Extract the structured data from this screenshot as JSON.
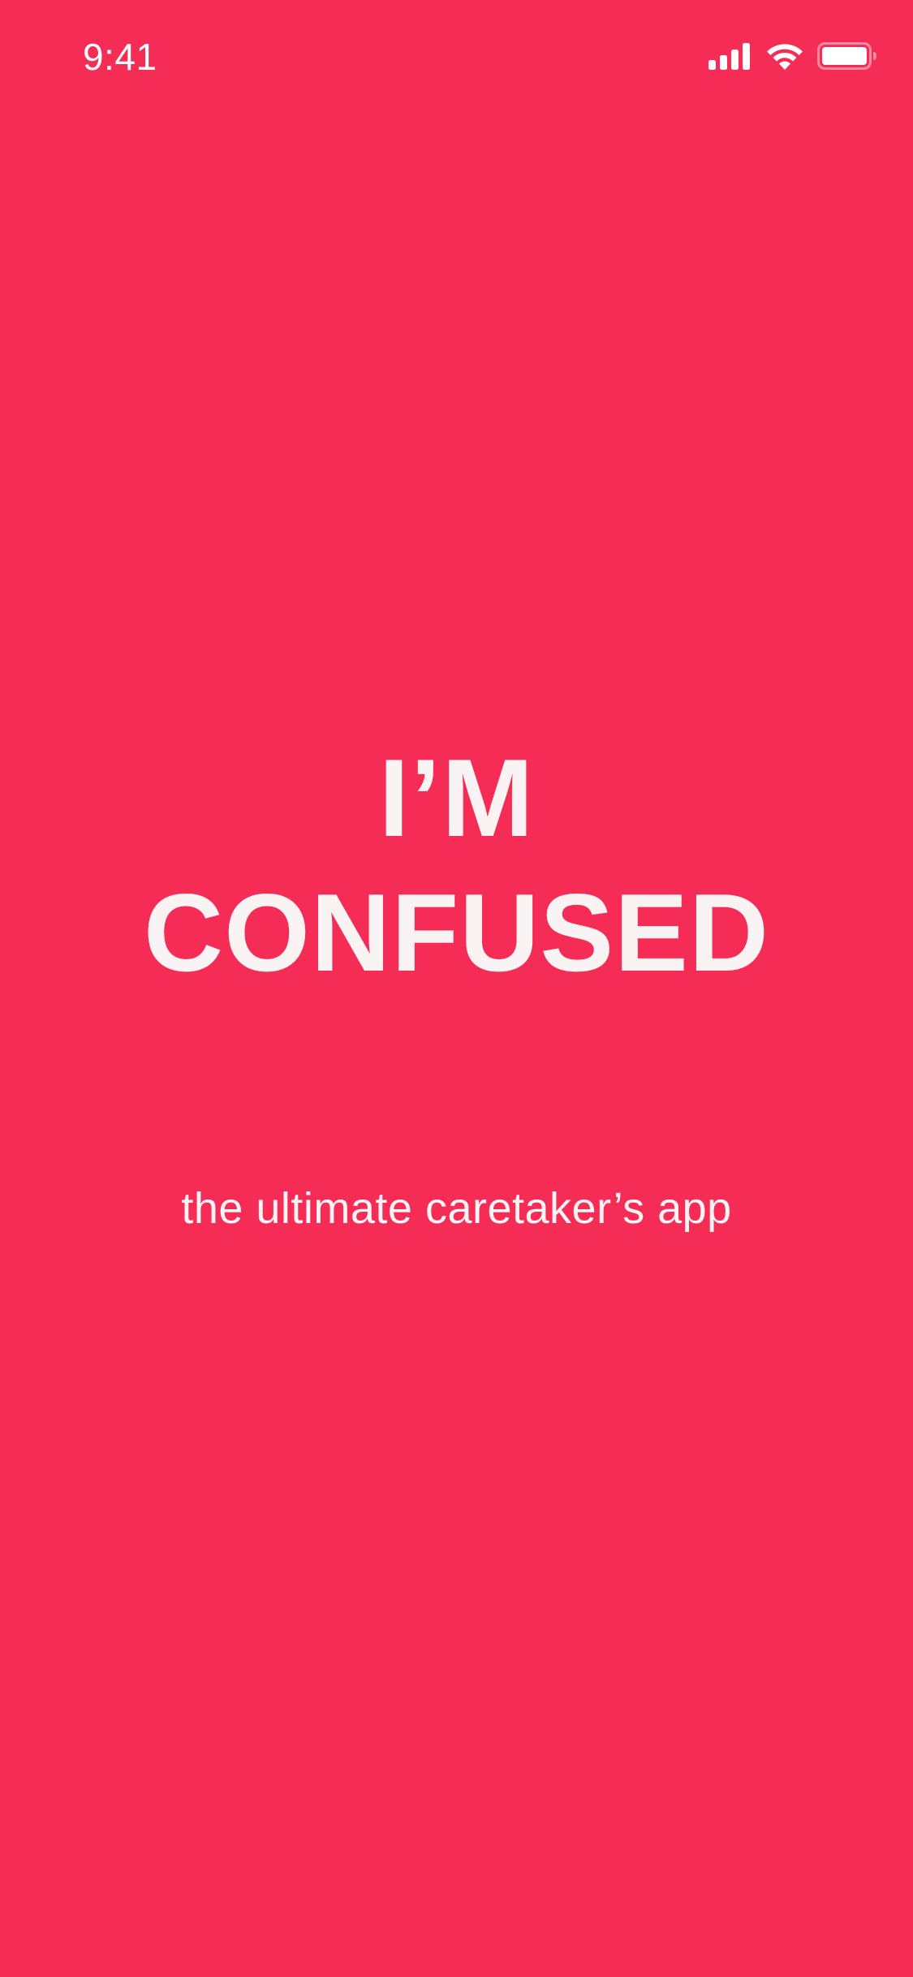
{
  "status_bar": {
    "time": "9:41",
    "icons": [
      "cellular-signal-icon",
      "wifi-icon",
      "battery-icon"
    ]
  },
  "splash": {
    "headline_line1": "I’M",
    "headline_line2": "CONFUSED",
    "tagline": "the ultimate caretaker’s app"
  },
  "colors": {
    "background": "#F52D56",
    "text": "#FAF3F3"
  }
}
